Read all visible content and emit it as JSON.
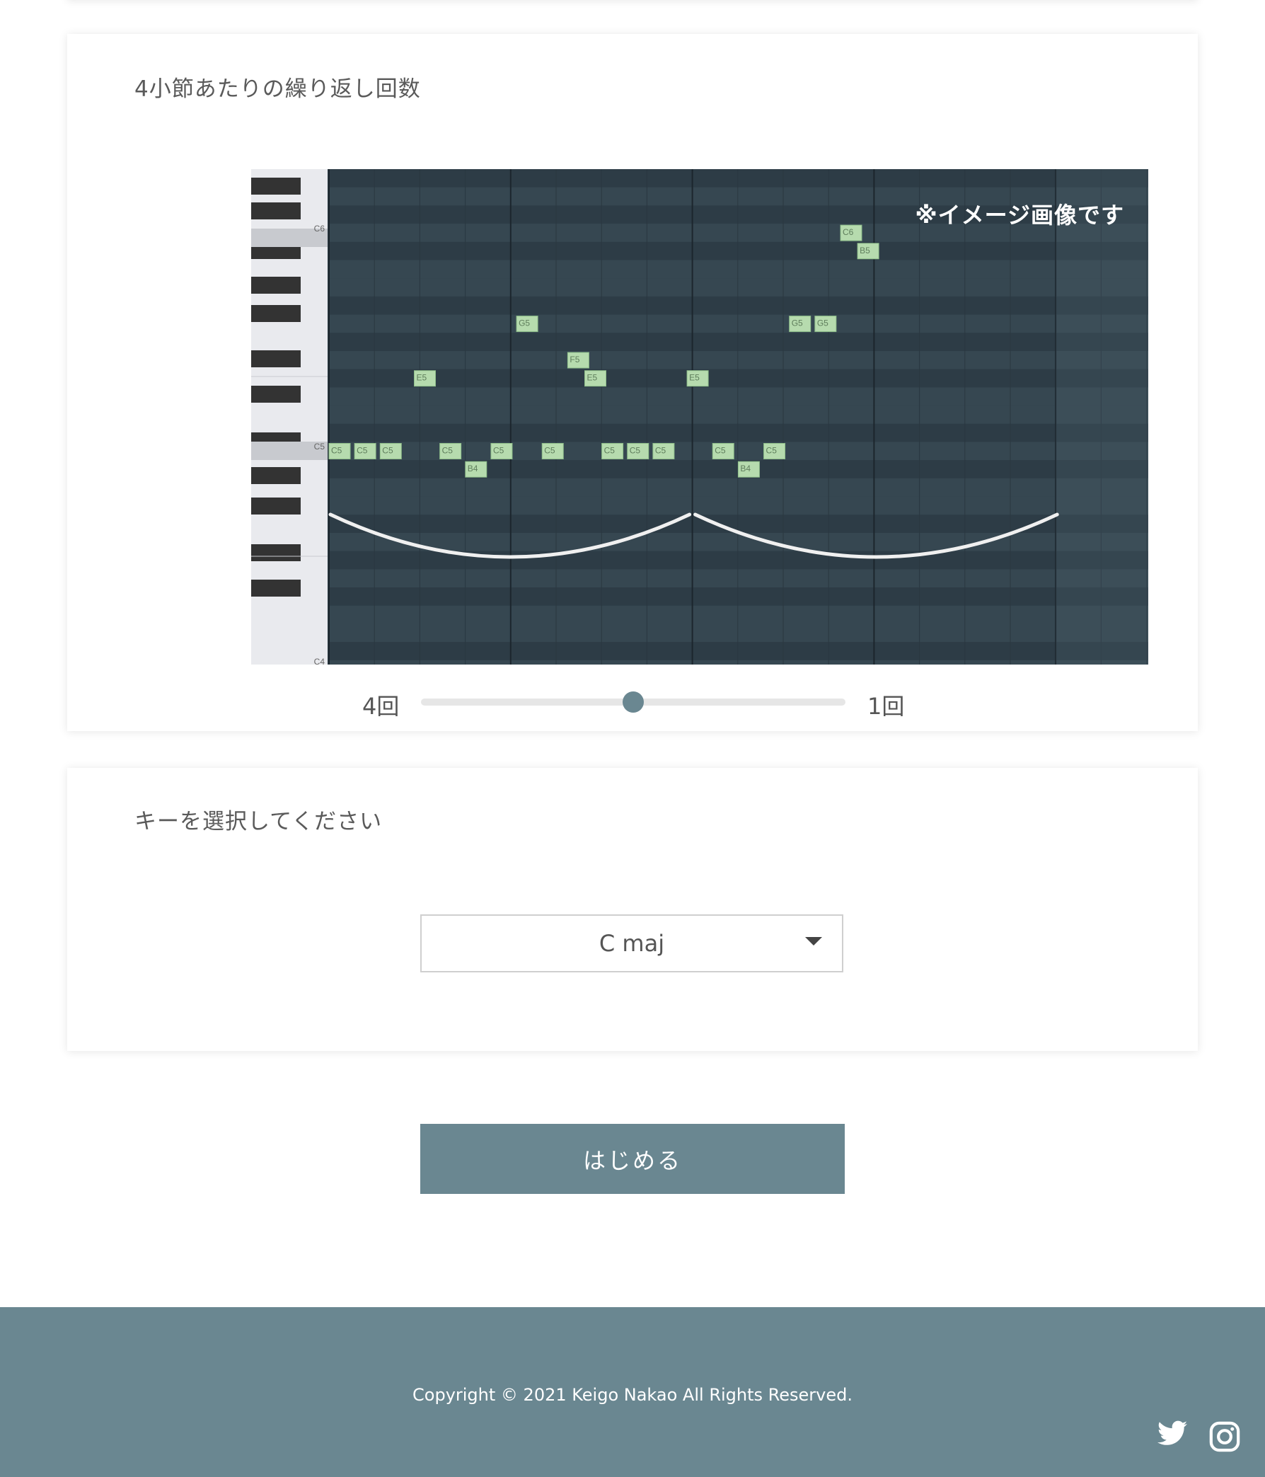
{
  "repeat_section": {
    "title": "4小節あたりの繰り返し回数",
    "image_note": "※イメージ画像です",
    "piano_labels": [
      "C6",
      "C5",
      "C4"
    ],
    "notes": [
      {
        "label": "C5",
        "beat": 0,
        "pitch": "C5"
      },
      {
        "label": "C5",
        "beat": 0.75,
        "pitch": "C5"
      },
      {
        "label": "C5",
        "beat": 1.5,
        "pitch": "C5"
      },
      {
        "label": "E5",
        "beat": 2.5,
        "pitch": "E5"
      },
      {
        "label": "C5",
        "beat": 3.25,
        "pitch": "C5"
      },
      {
        "label": "B4",
        "beat": 4,
        "pitch": "B4"
      },
      {
        "label": "C5",
        "beat": 4.75,
        "pitch": "C5"
      },
      {
        "label": "G5",
        "beat": 5.5,
        "pitch": "G5"
      },
      {
        "label": "C5",
        "beat": 6.25,
        "pitch": "C5"
      },
      {
        "label": "F5",
        "beat": 7,
        "pitch": "F5"
      },
      {
        "label": "E5",
        "beat": 7.5,
        "pitch": "E5"
      },
      {
        "label": "C5",
        "beat": 8,
        "pitch": "C5"
      },
      {
        "label": "C5",
        "beat": 8.75,
        "pitch": "C5"
      },
      {
        "label": "C5",
        "beat": 9.5,
        "pitch": "C5"
      },
      {
        "label": "E5",
        "beat": 10.5,
        "pitch": "E5"
      },
      {
        "label": "C5",
        "beat": 11.25,
        "pitch": "C5"
      },
      {
        "label": "B4",
        "beat": 12,
        "pitch": "B4"
      },
      {
        "label": "C5",
        "beat": 12.75,
        "pitch": "C5"
      },
      {
        "label": "G5",
        "beat": 13.5,
        "pitch": "G5"
      },
      {
        "label": "G5",
        "beat": 14.25,
        "pitch": "G5"
      },
      {
        "label": "C6",
        "beat": 15,
        "pitch": "C6"
      },
      {
        "label": "B5",
        "beat": 15.5,
        "pitch": "B5"
      }
    ],
    "slider": {
      "left_label": "4回",
      "right_label": "1回",
      "value_fraction": 0.5
    }
  },
  "key_section": {
    "title": "キーを選択してください",
    "selected_key": "C maj"
  },
  "start_button": "はじめる",
  "footer": {
    "copyright": "Copyright © 2021 Keigo Nakao All Rights Reserved.",
    "icons": [
      "twitter-icon",
      "instagram-icon"
    ]
  },
  "colors": {
    "accent": "#6a8791",
    "roll_background": "#2f3f49",
    "note_fill": "#b6dbae"
  }
}
